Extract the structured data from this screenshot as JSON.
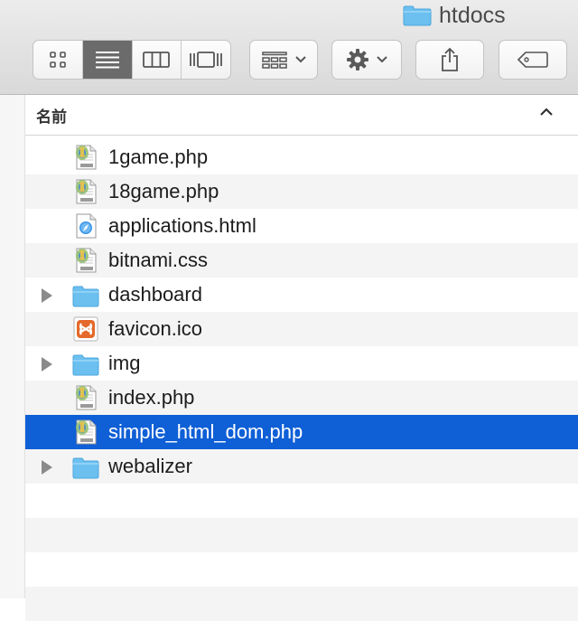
{
  "window": {
    "title": "htdocs",
    "title_icon": "folder-icon"
  },
  "toolbar": {
    "view_modes": [
      {
        "name": "icon-view",
        "icon": "grid-icon",
        "active": false
      },
      {
        "name": "list-view",
        "icon": "list-icon",
        "active": true
      },
      {
        "name": "column-view",
        "icon": "columns-icon",
        "active": false
      },
      {
        "name": "gallery-view",
        "icon": "cover-flow-icon",
        "active": false
      }
    ],
    "buttons": [
      "group-by",
      "action-gear",
      "share",
      "tags"
    ]
  },
  "column_header": {
    "name_label": "名前",
    "sort": "ascending"
  },
  "files": [
    {
      "name": "1game.php",
      "type": "php",
      "folder": false,
      "selected": false
    },
    {
      "name": "18game.php",
      "type": "php",
      "folder": false,
      "selected": false
    },
    {
      "name": "applications.html",
      "type": "html",
      "folder": false,
      "selected": false
    },
    {
      "name": "bitnami.css",
      "type": "php",
      "folder": false,
      "selected": false
    },
    {
      "name": "dashboard",
      "type": "folder",
      "folder": true,
      "selected": false
    },
    {
      "name": "favicon.ico",
      "type": "ico",
      "folder": false,
      "selected": false
    },
    {
      "name": "img",
      "type": "folder",
      "folder": true,
      "selected": false
    },
    {
      "name": "index.php",
      "type": "php",
      "folder": false,
      "selected": false
    },
    {
      "name": "simple_html_dom.php",
      "type": "php",
      "folder": false,
      "selected": true
    },
    {
      "name": "webalizer",
      "type": "folder",
      "folder": true,
      "selected": false
    }
  ],
  "colors": {
    "selection": "#0f5fd6",
    "folder": "#6cc0f0",
    "ico": "#e4692a"
  }
}
